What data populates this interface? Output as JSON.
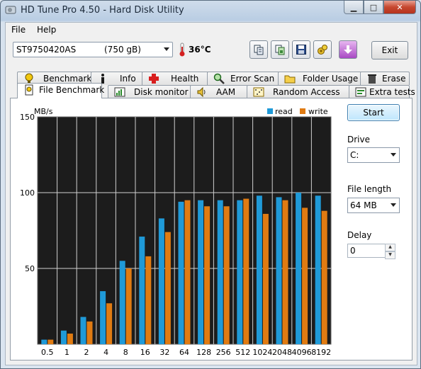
{
  "window": {
    "title": "HD Tune Pro 4.50 - Hard Disk Utility"
  },
  "menu": {
    "file": "File",
    "help": "Help"
  },
  "toolbar": {
    "drive_name": "ST9750420AS",
    "drive_capacity": "(750 gB)",
    "temperature": "36°C",
    "exit_label": "Exit",
    "buttons": [
      "copy-text-icon",
      "copy-screenshot-icon",
      "save-icon",
      "options-icon",
      "download-icon"
    ]
  },
  "tabs_top": [
    "Benchmark",
    "Info",
    "Health",
    "Error Scan",
    "Folder Usage",
    "Erase"
  ],
  "tabs_bottom": [
    "File Benchmark",
    "Disk monitor",
    "AAM",
    "Random Access",
    "Extra tests"
  ],
  "active_tab": "File Benchmark",
  "side": {
    "start_label": "Start",
    "drive_label": "Drive",
    "drive_value": "C:",
    "file_length_label": "File length",
    "file_length_value": "64 MB",
    "delay_label": "Delay",
    "delay_value": "0"
  },
  "colors": {
    "read": "#1f9ad8",
    "write": "#e07b12",
    "plot_bg": "#1c1c1c",
    "grid": "#d0d0d0"
  },
  "chart_data": {
    "type": "bar",
    "ylabel": "MB/s",
    "ylim": [
      0,
      150
    ],
    "yticks": [
      50,
      100,
      150
    ],
    "legend_position": "top-right",
    "categories": [
      "0.5",
      "1",
      "2",
      "4",
      "8",
      "16",
      "32",
      "64",
      "128",
      "256",
      "512",
      "1024",
      "2048",
      "4096",
      "8192"
    ],
    "series": [
      {
        "name": "read",
        "values": [
          3,
          9,
          18,
          35,
          55,
          71,
          83,
          94,
          95,
          95,
          95,
          98,
          97,
          100,
          98
        ]
      },
      {
        "name": "write",
        "values": [
          3,
          7,
          15,
          27,
          50,
          58,
          74,
          95,
          91,
          91,
          96,
          86,
          95,
          90,
          88
        ]
      }
    ]
  }
}
